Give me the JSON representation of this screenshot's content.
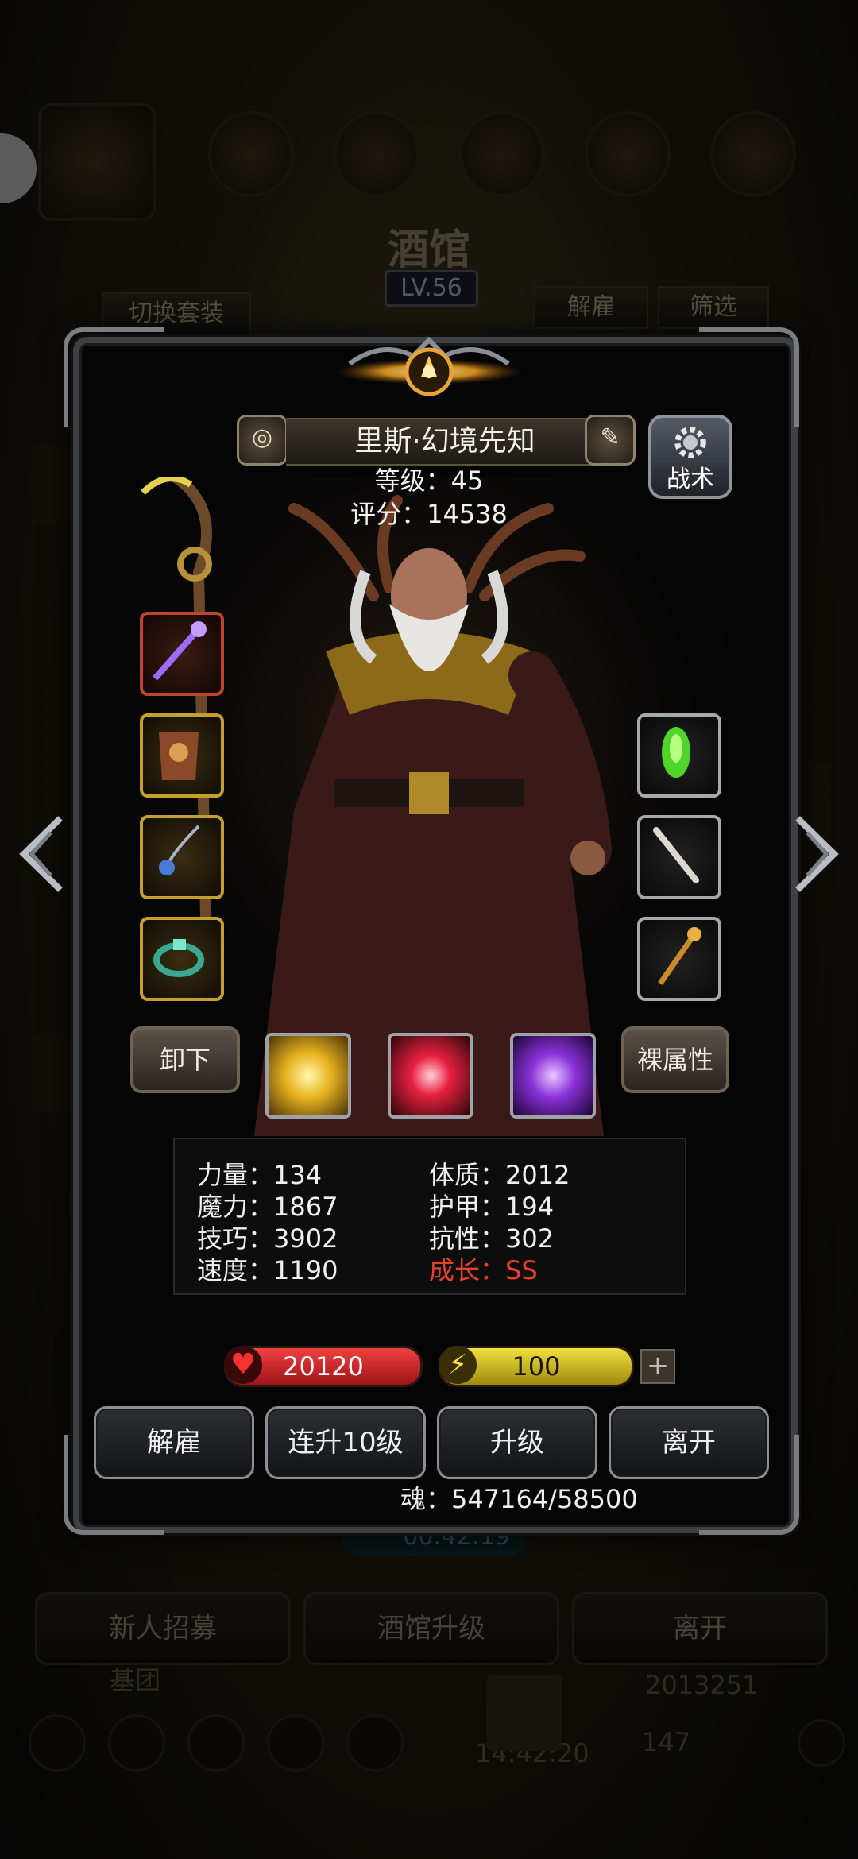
{
  "background": {
    "title": "酒馆",
    "level": "LV.56",
    "switch_outfit": "切换套装",
    "dismiss_top": "解雇",
    "filter": "筛选",
    "timer": "00:42:19",
    "recruit": "新人招募",
    "upgrade_tavern": "酒馆升级",
    "leave": "离开",
    "guild": "基团",
    "gold": "2013251",
    "clock": "14:42:20",
    "gems": "147"
  },
  "hero": {
    "name": "里斯·幻境先知",
    "level_line": "等级：45",
    "score_line": "评分：14538",
    "tactics": "战术"
  },
  "equipment_left": [
    {
      "icon": "staff-icon"
    },
    {
      "icon": "armor-icon"
    },
    {
      "icon": "amulet-icon"
    },
    {
      "icon": "ring-icon"
    }
  ],
  "equipment_right": [
    {
      "icon": "gem-icon"
    },
    {
      "icon": "bone-icon"
    },
    {
      "icon": "scepter-icon"
    }
  ],
  "buttons": {
    "unequip": "卸下",
    "base_attributes": "裸属性",
    "dismiss": "解雇",
    "level_up_10": "连升10级",
    "level_up": "升级",
    "leave": "离开",
    "plus": "+"
  },
  "stats": {
    "strength": "力量：134",
    "magic": "魔力：1867",
    "skill": "技巧：3902",
    "speed": "速度：1190",
    "constitution": "体质：2012",
    "armor": "护甲：194",
    "resistance": "抗性：302",
    "growth": "成长：SS"
  },
  "bars": {
    "health": "20120",
    "energy": "100"
  },
  "soul": "魂：547164/58500",
  "colors": {
    "growth": "#e8412b",
    "health": "#d8232a",
    "energy": "#d8c21c"
  }
}
